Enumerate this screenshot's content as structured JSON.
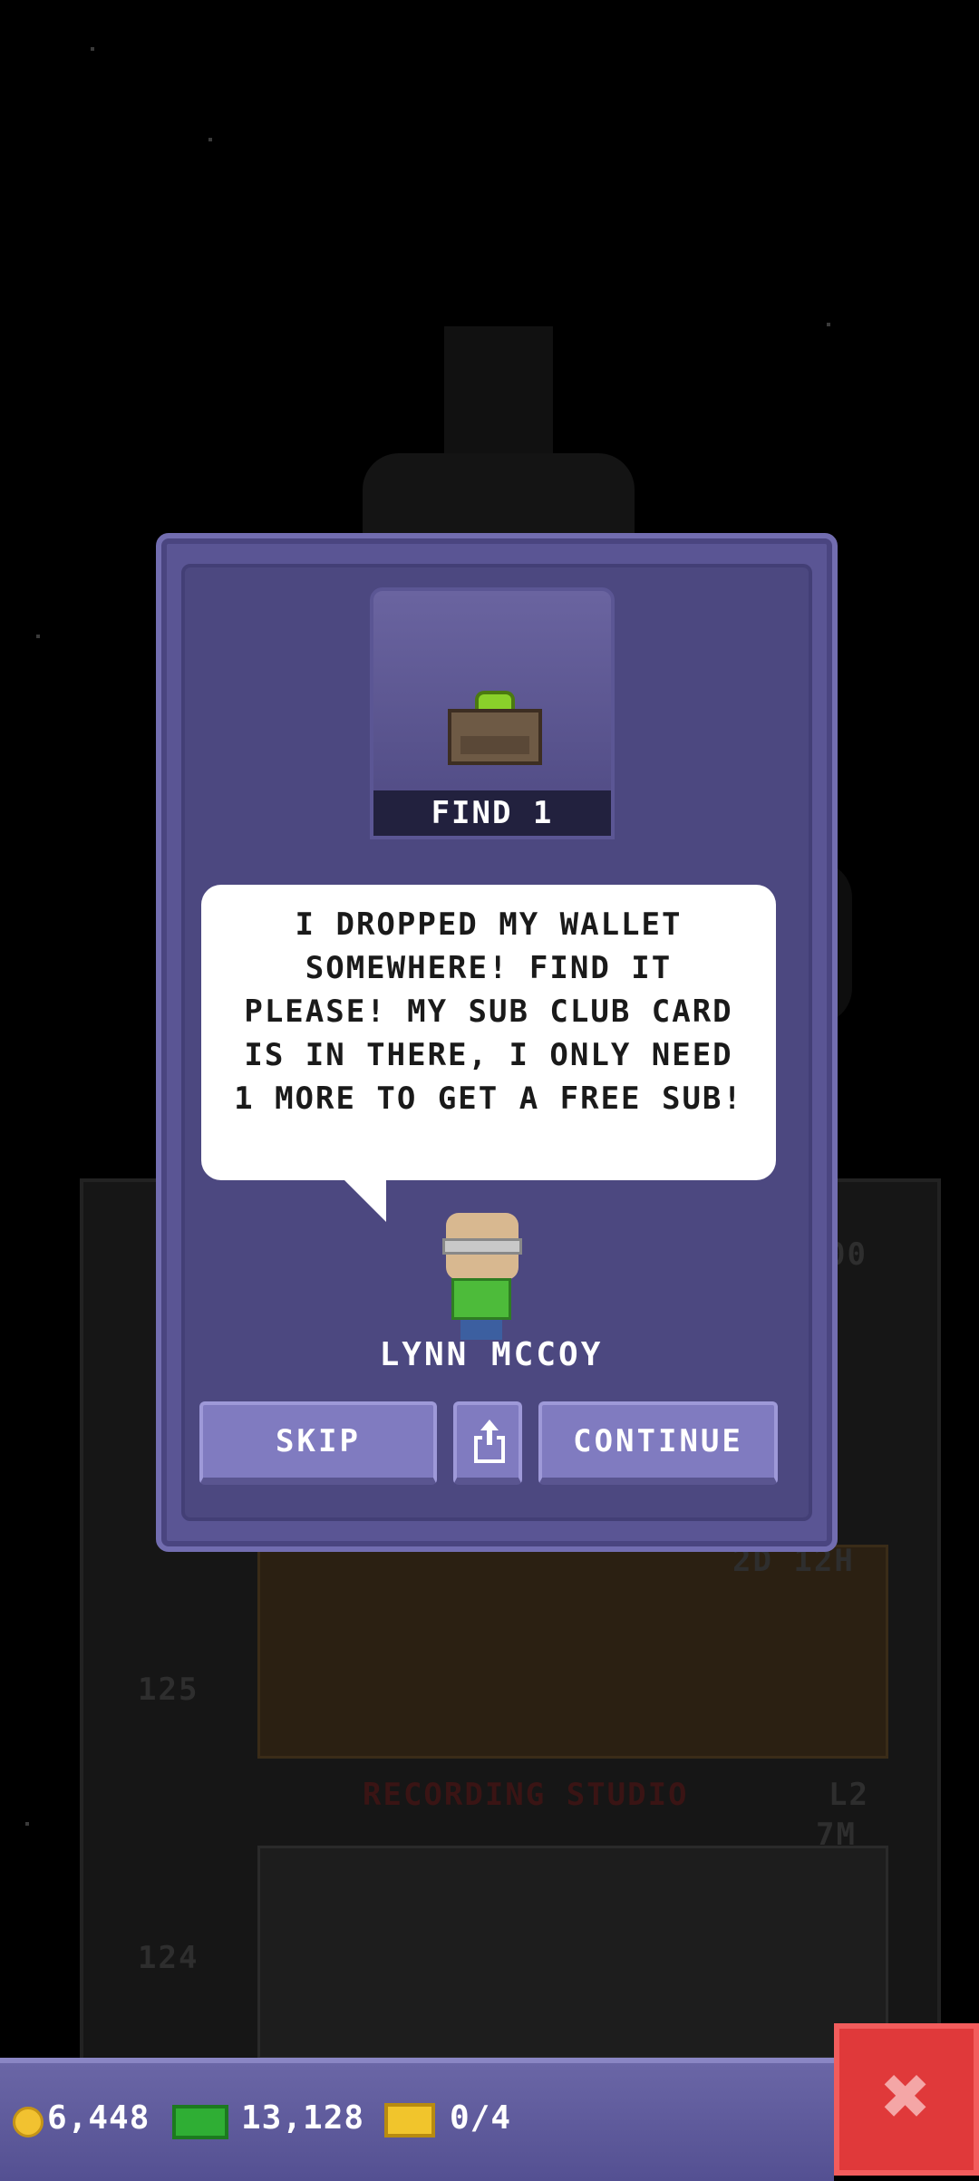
{
  "mission": {
    "find_label": "FIND 1",
    "item_icon": "wallet-icon",
    "message": "I DROPPED MY WALLET SOMEWHERE! FIND IT PLEASE! MY SUB CLUB CARD IS IN THERE, I ONLY NEED 1 MORE TO GET A FREE SUB!",
    "character_name": "LYNN MCCOY"
  },
  "buttons": {
    "skip": "SKIP",
    "share_icon": "share-icon",
    "continue": "CONTINUE"
  },
  "status_bar": {
    "coins": "6,448",
    "bux": "13,128",
    "tickets": "0/4"
  },
  "background": {
    "floor_timer": "2D 12H",
    "floor_name": "RECORDING STUDIO",
    "floor_level": "L2",
    "floor_value": "7M",
    "floor_number_upper": "125",
    "floor_number_lower": "124",
    "top_timer": "00"
  },
  "colors": {
    "dialog_bg": "#5a5594",
    "button": "#807bc0",
    "close": "#e0393a",
    "bubble": "#ffffff"
  }
}
